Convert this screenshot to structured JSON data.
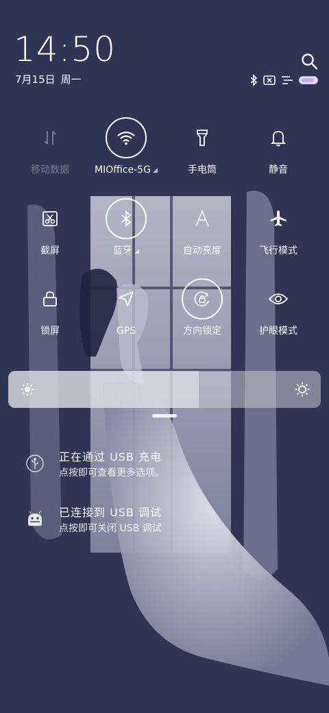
{
  "status_bar": {
    "time": "14:50",
    "date": "7月15日",
    "weekday": "周一"
  },
  "tiles": [
    {
      "label": "移动数据",
      "icon": "mobile-data-icon",
      "active": false
    },
    {
      "label": "MIOffice-5G",
      "icon": "wifi-icon",
      "active": true
    },
    {
      "label": "手电筒",
      "icon": "flashlight-icon",
      "active": false
    },
    {
      "label": "静音",
      "icon": "bell-icon",
      "active": false
    },
    {
      "label": "截屏",
      "icon": "screenshot-icon",
      "active": false
    },
    {
      "label": "蓝牙",
      "icon": "bluetooth-icon",
      "active": true
    },
    {
      "label": "自动亮度",
      "icon": "auto-brightness-icon",
      "active": false
    },
    {
      "label": "飞行模式",
      "icon": "airplane-icon",
      "active": false
    },
    {
      "label": "锁屏",
      "icon": "lock-icon",
      "active": false
    },
    {
      "label": "GPS",
      "icon": "gps-icon",
      "active": false
    },
    {
      "label": "方向锁定",
      "icon": "rotation-lock-icon",
      "active": true
    },
    {
      "label": "护眼模式",
      "icon": "eye-icon",
      "active": false
    }
  ],
  "brightness": {
    "level": 0.61
  },
  "notifications": [
    {
      "title": "正在通过 USB 充电",
      "subtitle": "点按即可查看更多选项。",
      "icon": "usb-icon"
    },
    {
      "title": "已连接到 USB 调试",
      "subtitle": "点按即可关闭 USB 调试",
      "icon": "android-debug-icon"
    }
  ],
  "colors": {
    "background": "#2f3654",
    "accent": "#ffffff",
    "battery": "#c7a6ff"
  }
}
